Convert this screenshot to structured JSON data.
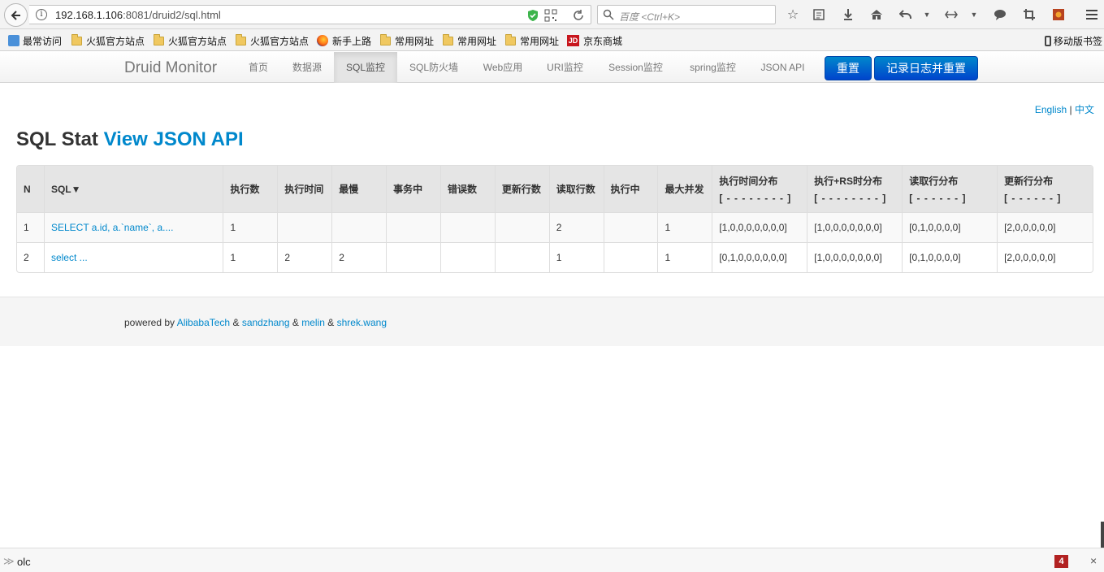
{
  "browser": {
    "url_host": "192.168.1.106",
    "url_rest": ":8081/druid2/sql.html",
    "info_glyph": "i",
    "search_placeholder": "百度 <Ctrl+K>",
    "bookmarks": [
      {
        "label": "最常访问",
        "icon": "recent-icon"
      },
      {
        "label": "火狐官方站点",
        "icon": "folder-icon"
      },
      {
        "label": "火狐官方站点",
        "icon": "folder-icon"
      },
      {
        "label": "火狐官方站点",
        "icon": "folder-icon"
      },
      {
        "label": "新手上路",
        "icon": "firefox-icon"
      },
      {
        "label": "常用网址",
        "icon": "folder-icon"
      },
      {
        "label": "常用网址",
        "icon": "folder-icon"
      },
      {
        "label": "常用网址",
        "icon": "folder-icon"
      },
      {
        "label": "京东商城",
        "icon": "jd-icon"
      }
    ],
    "jd_glyph": "JD",
    "mobile_bookmarks": "移动版书签"
  },
  "nav": {
    "brand": "Druid Monitor",
    "items": [
      "首页",
      "数据源",
      "SQL监控",
      "SQL防火墙",
      "Web应用",
      "URI监控",
      "Session监控",
      "spring监控",
      "JSON API"
    ],
    "active_index": 2,
    "reset_label": "重置",
    "log_reset_label": "记录日志并重置"
  },
  "lang": {
    "english": "English",
    "separator": "|",
    "chinese": "中文"
  },
  "page": {
    "title": "SQL Stat",
    "title_link": "View JSON API"
  },
  "table": {
    "headers": [
      "N",
      "SQL▼",
      "执行数",
      "执行时间",
      "最慢",
      "事务中",
      "错误数",
      "更新行数",
      "读取行数",
      "执行中",
      "最大并发"
    ],
    "dist_headers": [
      {
        "label": "执行时间分布",
        "sub": "[ - - - - - - - - ]"
      },
      {
        "label": "执行+RS时分布",
        "sub": "[ - - - - - - - - ]"
      },
      {
        "label": "读取行分布",
        "sub": "[ - - - - - - ]"
      },
      {
        "label": "更新行分布",
        "sub": "[ - - - - - - ]"
      }
    ],
    "rows": [
      {
        "n": "1",
        "sql": "SELECT a.id, a.`name`, a....",
        "exec": "1",
        "exec_time": "",
        "slowest": "",
        "in_tx": "",
        "errors": "",
        "updated": "",
        "fetched": "2",
        "running": "",
        "max_concurrent": "1",
        "dist_exec": "[1,0,0,0,0,0,0,0]",
        "dist_exec_rs": "[1,0,0,0,0,0,0,0]",
        "dist_fetch": "[0,1,0,0,0,0]",
        "dist_update": "[2,0,0,0,0,0]"
      },
      {
        "n": "2",
        "sql": "select ...",
        "exec": "1",
        "exec_time": "2",
        "slowest": "2",
        "in_tx": "",
        "errors": "",
        "updated": "",
        "fetched": "1",
        "running": "",
        "max_concurrent": "1",
        "dist_exec": "[0,1,0,0,0,0,0,0]",
        "dist_exec_rs": "[1,0,0,0,0,0,0,0]",
        "dist_fetch": "[0,1,0,0,0,0]",
        "dist_update": "[2,0,0,0,0,0]"
      }
    ]
  },
  "footer": {
    "prefix": "powered by",
    "links": [
      "AlibabaTech",
      "sandzhang",
      "melin",
      "shrek.wang"
    ],
    "amp": "&"
  },
  "status": {
    "prompt": "≫",
    "command": "olc",
    "badge": "4",
    "close": "×"
  },
  "colors": {
    "accent": "#0088cc",
    "button_top": "#0088cc",
    "button_bottom": "#0044cc",
    "badge": "#b22222"
  }
}
